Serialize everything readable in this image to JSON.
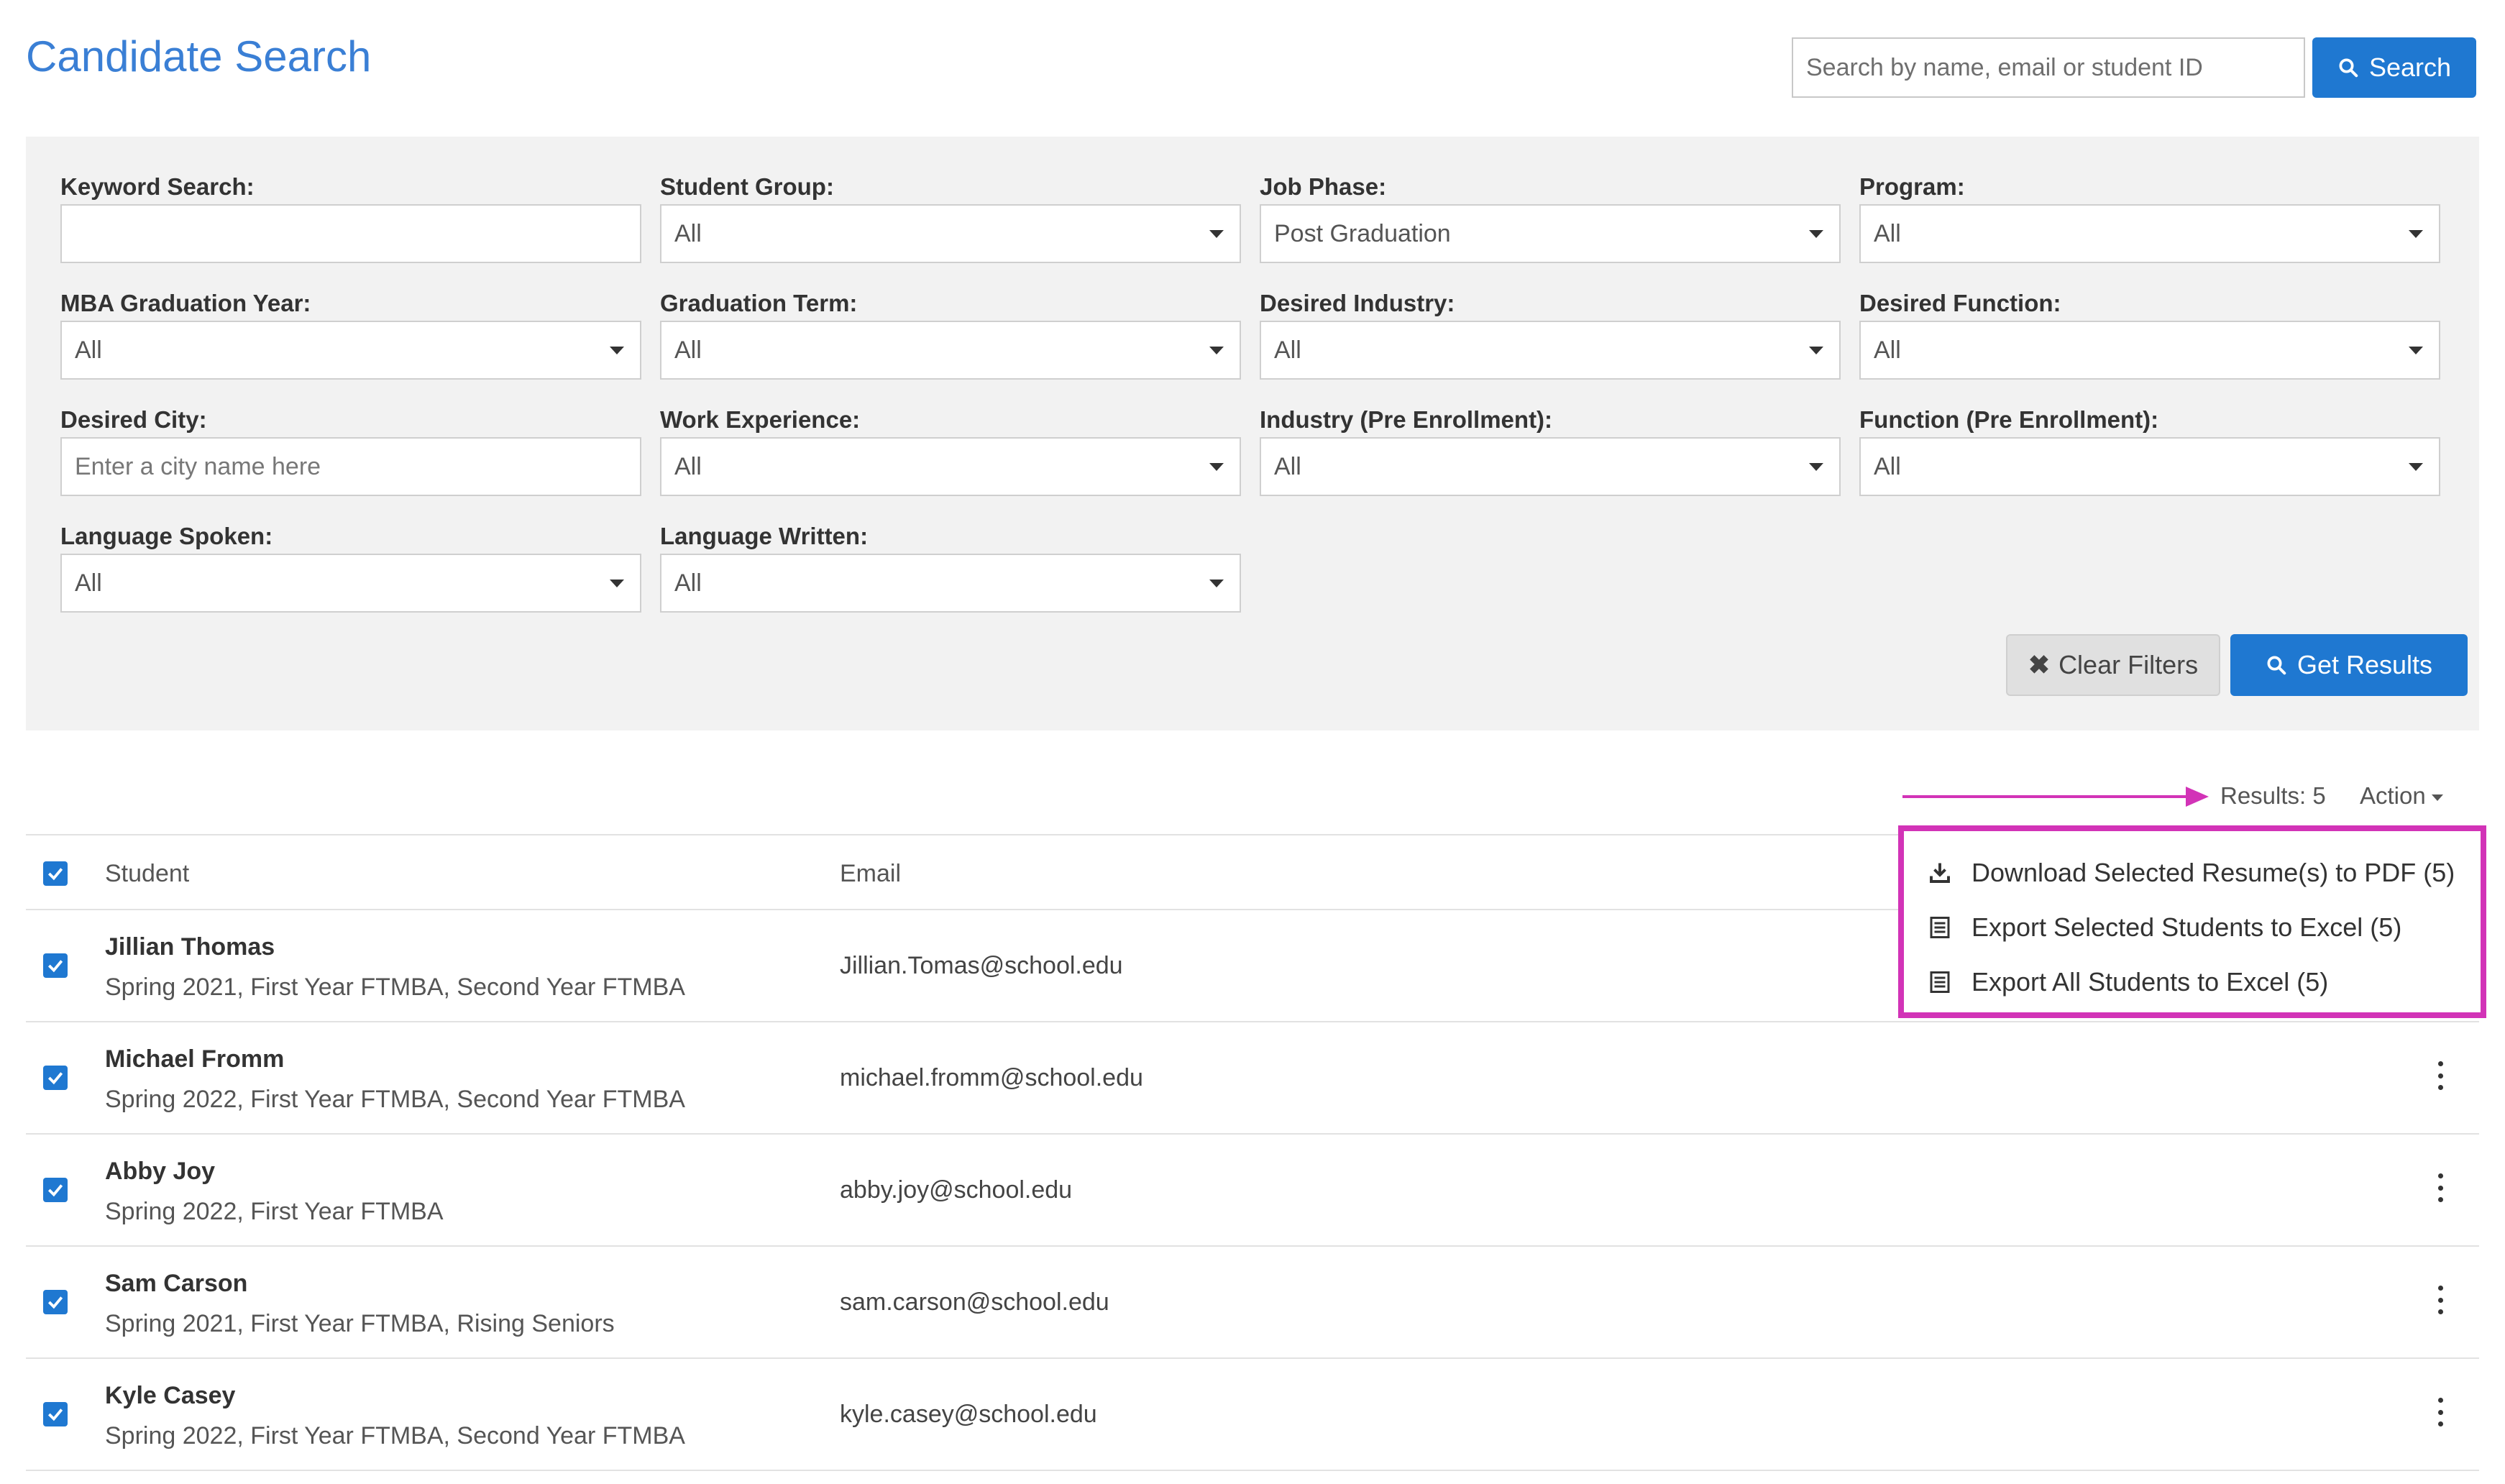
{
  "page_title": "Candidate Search",
  "top_search": {
    "placeholder": "Search by name, email or student ID",
    "button": "Search"
  },
  "filters": {
    "keyword": {
      "label": "Keyword Search:",
      "value": ""
    },
    "student_group": {
      "label": "Student Group:",
      "value": "All"
    },
    "job_phase": {
      "label": "Job Phase:",
      "value": "Post Graduation"
    },
    "program": {
      "label": "Program:",
      "value": "All"
    },
    "mba_grad_year": {
      "label": "MBA Graduation Year:",
      "value": "All"
    },
    "grad_term": {
      "label": "Graduation Term:",
      "value": "All"
    },
    "desired_industry": {
      "label": "Desired Industry:",
      "value": "All"
    },
    "desired_function": {
      "label": "Desired Function:",
      "value": "All"
    },
    "desired_city": {
      "label": "Desired City:",
      "placeholder": "Enter a city name here"
    },
    "work_experience": {
      "label": "Work Experience:",
      "value": "All"
    },
    "industry_pre": {
      "label": "Industry (Pre Enrollment):",
      "value": "All"
    },
    "function_pre": {
      "label": "Function (Pre Enrollment):",
      "value": "All"
    },
    "language_spoken": {
      "label": "Language Spoken:",
      "value": "All"
    },
    "language_written": {
      "label": "Language Written:",
      "value": "All"
    },
    "clear_button": "Clear Filters",
    "get_results_button": "Get Results"
  },
  "results": {
    "label": "Results: 5",
    "action": "Action"
  },
  "table": {
    "headers": {
      "student": "Student",
      "email": "Email"
    },
    "rows": [
      {
        "name": "Jillian Thomas",
        "details": "Spring 2021, First Year FTMBA, Second Year FTMBA",
        "email": "Jillian.Tomas@school.edu"
      },
      {
        "name": "Michael Fromm",
        "details": "Spring 2022, First Year FTMBA, Second Year FTMBA",
        "email": "michael.fromm@school.edu"
      },
      {
        "name": "Abby Joy",
        "details": "Spring 2022, First Year FTMBA",
        "email": "abby.joy@school.edu"
      },
      {
        "name": "Sam Carson",
        "details": "Spring 2021, First Year FTMBA, Rising Seniors",
        "email": "sam.carson@school.edu"
      },
      {
        "name": "Kyle Casey",
        "details": "Spring 2022, First Year FTMBA, Second Year FTMBA",
        "email": "kyle.casey@school.edu"
      }
    ]
  },
  "action_menu": {
    "items": [
      {
        "label": "Download Selected Resume(s) to PDF (5)",
        "icon": "download-icon"
      },
      {
        "label": "Export Selected Students to Excel (5)",
        "icon": "spreadsheet-icon"
      },
      {
        "label": "Export All Students to Excel (5)",
        "icon": "spreadsheet-icon"
      }
    ]
  },
  "colors": {
    "accent": "#1f78d1",
    "title": "#3a7fd5",
    "highlight": "#d233b7",
    "panel": "#f2f2f2"
  }
}
